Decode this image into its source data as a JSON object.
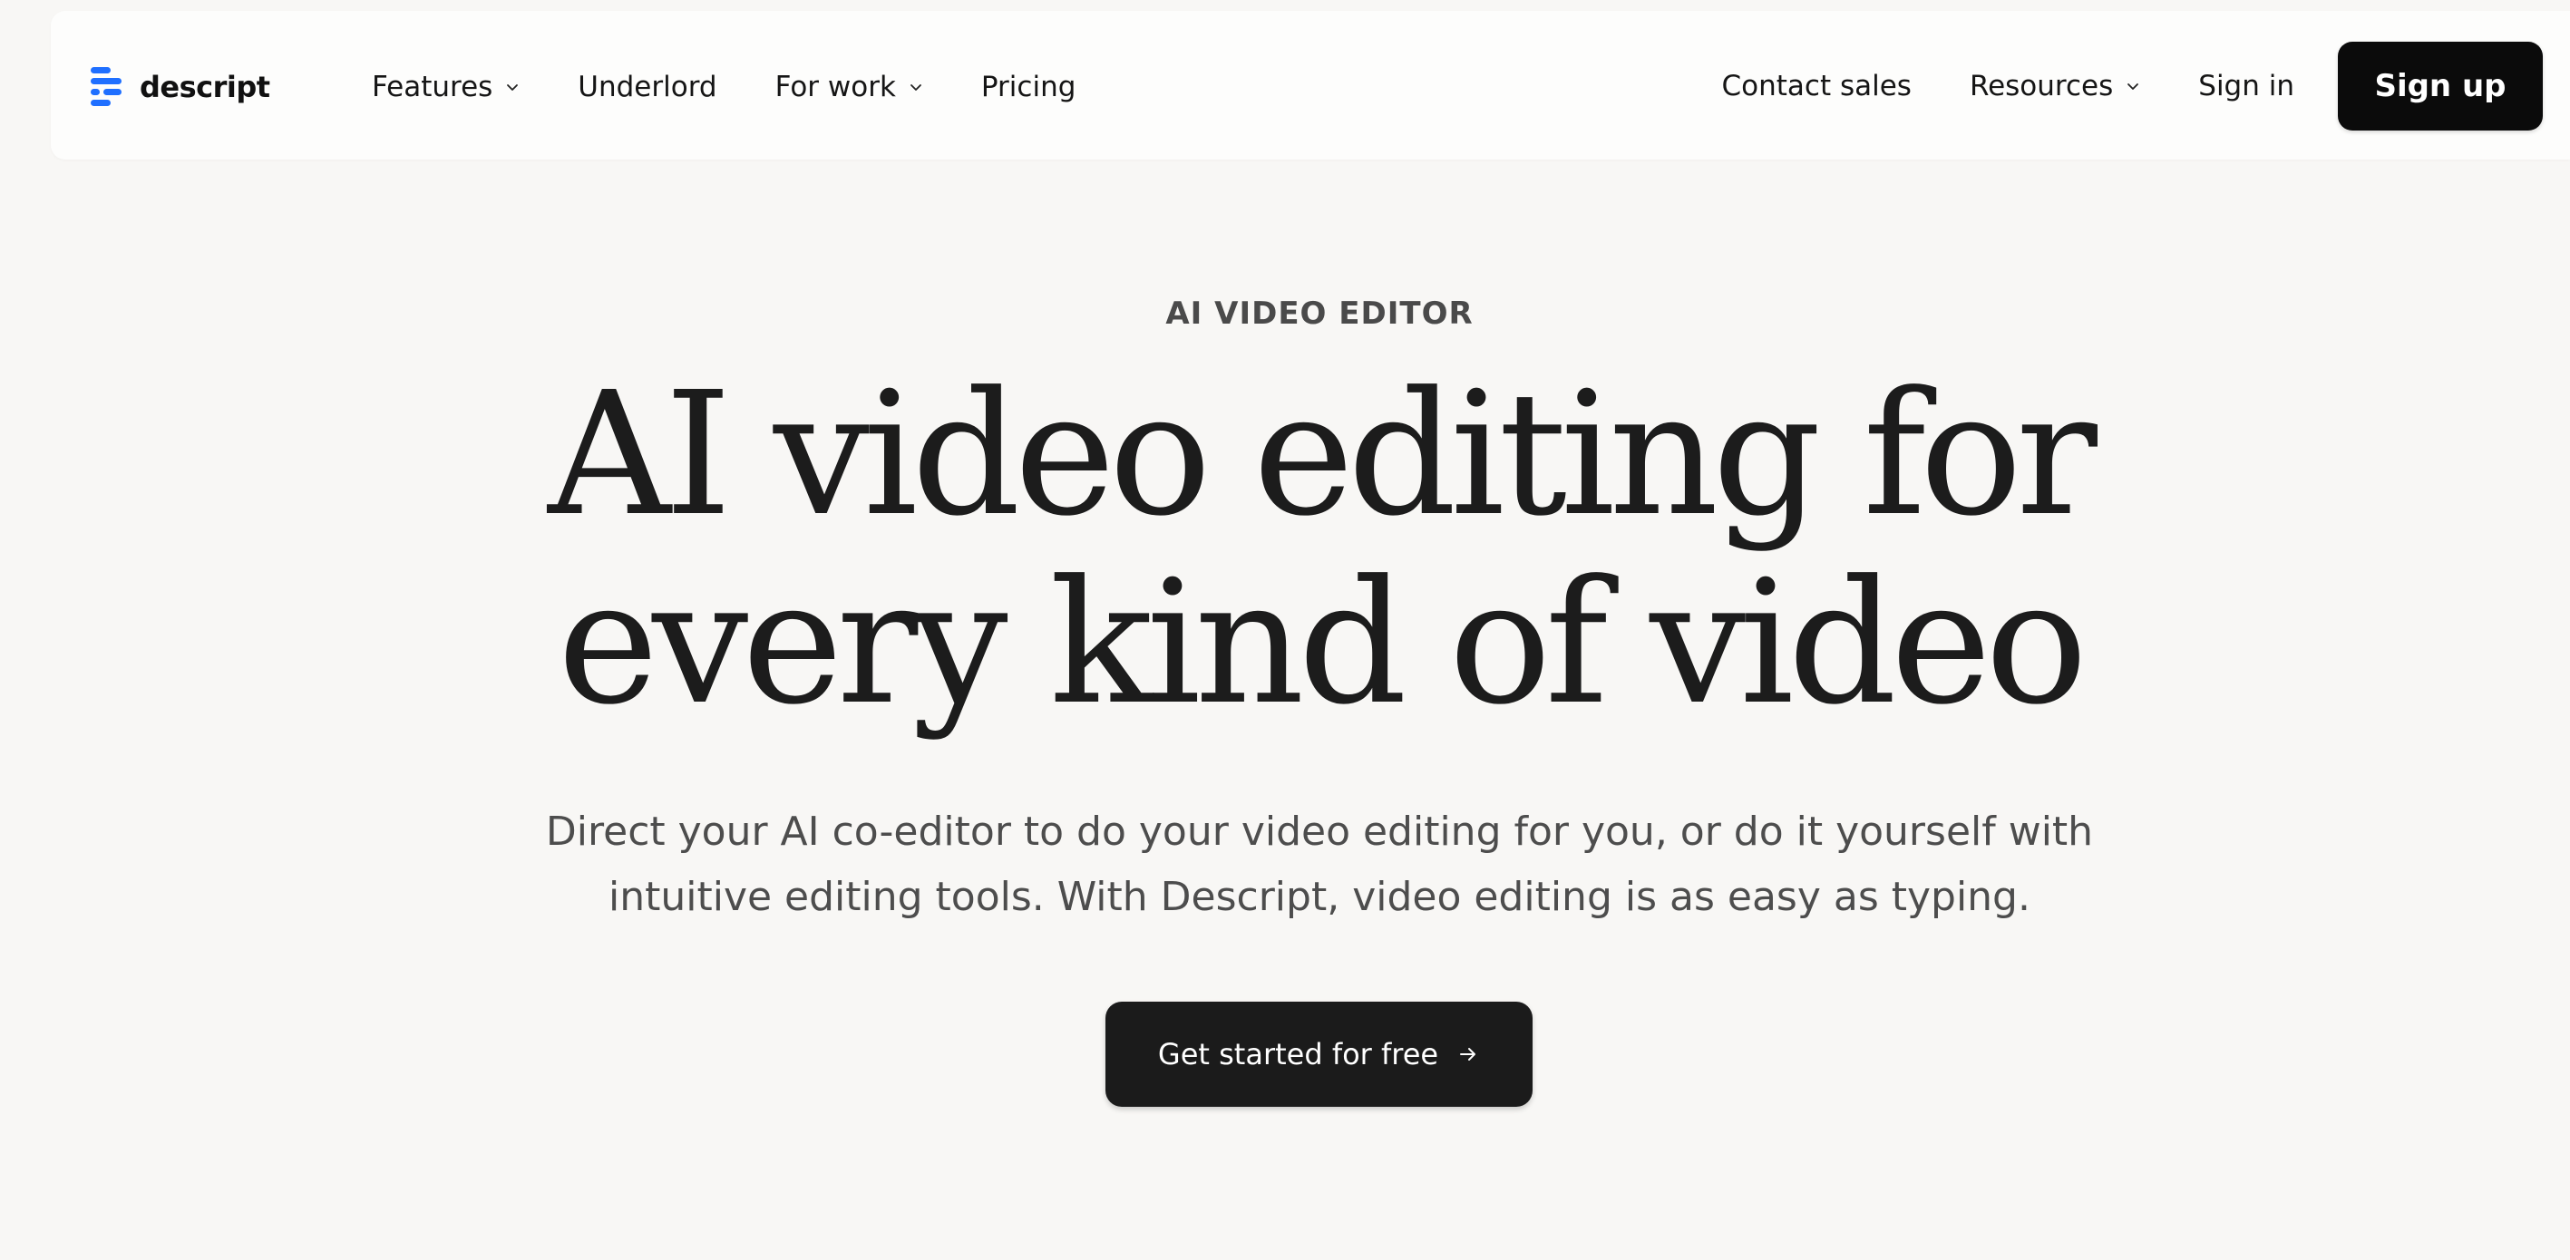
{
  "nav": {
    "logo_text": "descript",
    "left_items": [
      {
        "label": "Features"
      },
      {
        "label": "Underlord"
      },
      {
        "label": "For work"
      },
      {
        "label": "Pricing"
      }
    ],
    "right_items": [
      {
        "label": "Contact sales"
      },
      {
        "label": "Resources"
      },
      {
        "label": "Sign in"
      }
    ],
    "signup_label": "Sign up"
  },
  "hero": {
    "eyebrow": "AI VIDEO EDITOR",
    "headline_lines": [
      "AI video editing for",
      "every kind of video"
    ],
    "subtitle_lines": [
      "Direct your AI co-editor to do your video editing for you, or do it yourself with",
      "intuitive editing tools. With Descript, video editing is as easy as typing."
    ],
    "cta_label": "Get started for free"
  },
  "colors": {
    "background": "#f8f7f5",
    "navbar": "#fdfdfc",
    "brand_blue": "#1f6fff",
    "button_dark": "#0b0b0b",
    "text_primary": "#1c1c1c",
    "text_secondary": "#4d4d4d"
  },
  "icons": {
    "logo": "descript-logo-icon",
    "dropdown": "chevron-down-icon",
    "cta": "arrow-right-icon"
  }
}
